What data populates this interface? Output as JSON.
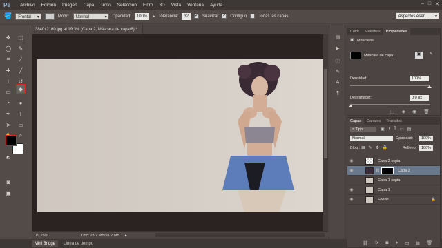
{
  "menubar": {
    "logo": "Ps",
    "items": [
      "Archivo",
      "Edición",
      "Imagen",
      "Capa",
      "Texto",
      "Selección",
      "Filtro",
      "3D",
      "Vista",
      "Ventana",
      "Ayuda"
    ],
    "window_controls": [
      "–",
      "□",
      "✕"
    ]
  },
  "options_bar": {
    "sample_mode": "Frontal",
    "mode_label": "Modo:",
    "mode_value": "Normal",
    "opacity_label": "Opacidad:",
    "opacity_value": "100%",
    "tolerance_label": "Tolerancia:",
    "tolerance_value": "32",
    "antialias_label": "Suavizar",
    "contiguous_label": "Contiguo",
    "all_layers_label": "Todas las capas",
    "workspace": "Aspectos esen..."
  },
  "document": {
    "tab_title": "3840x2160.jpg al 19,3% (Capa 2, Máscara de capa/8) *",
    "zoom": "19,25%",
    "doc_info": "Doc: 23,7 MB/91,2 MB"
  },
  "bottom_tabs": [
    "Mini Bridge",
    "Línea de tiempo"
  ],
  "properties": {
    "tabs": [
      "Color",
      "Muestras",
      "Propiedades"
    ],
    "section_title": "Máscaras",
    "mask_label": "Máscara de capa",
    "density_label": "Densidad:",
    "density_value": "100%",
    "feather_label": "Desvanecer:",
    "feather_value": "0,0 px"
  },
  "layers": {
    "tabs": [
      "Capas",
      "Canales",
      "Trazados"
    ],
    "filter_label": "Tipo",
    "blend_mode": "Normal",
    "opacity_label": "Opacidad:",
    "opacity_value": "100%",
    "lock_label": "Bloq.:",
    "fill_label": "Relleno:",
    "fill_value": "100%",
    "items": [
      {
        "name": "Capa 2 copia"
      },
      {
        "name": "Capa 2"
      },
      {
        "name": "Capa 1 copia"
      },
      {
        "name": "Capa 1"
      },
      {
        "name": "Fondo"
      }
    ]
  },
  "colors": {
    "foreground": "#000000",
    "background": "#ffffff",
    "selected_layer": "#6a7a8c",
    "tool_highlight": "#e02020"
  }
}
